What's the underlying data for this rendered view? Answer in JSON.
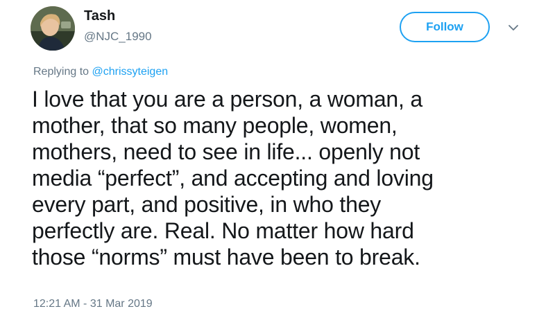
{
  "author": {
    "display_name": "Tash",
    "handle": "@NJC_1990"
  },
  "follow_label": "Follow",
  "more_icon": "chevron-down-icon",
  "reply": {
    "prefix": "Replying to",
    "mention": "@chrissyteigen"
  },
  "tweet_text": "I love that you are a person, a woman, a\nmother, that so many people, women,\nmothers, need to see in life... openly not\nmedia “perfect”, and accepting and loving\nevery part, and positive, in who they\nperfectly are. Real. No matter how hard\nthose “norms” must have been to break.",
  "timestamp": "12:21 AM - 31 Mar 2019",
  "colors": {
    "accent": "#1da1f2",
    "text": "#14171a",
    "secondary": "#657786"
  }
}
